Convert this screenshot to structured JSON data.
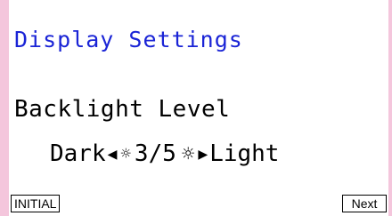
{
  "screen": {
    "title": "Display Settings",
    "setting_label": "Backlight Level"
  },
  "backlight": {
    "dark_label": "Dark",
    "light_label": "Light",
    "level_text": "3/5",
    "left_arrow": "◀",
    "right_arrow": "▶",
    "sun_small": "☼",
    "sun_large": "☼"
  },
  "function_keys": {
    "f1_label": "INITIAL",
    "f6_label": "Next"
  },
  "colors": {
    "title": "#1a24d6",
    "side_bar": "#f4c6dc"
  },
  "icons": [
    "left-arrow-icon",
    "sun-small-icon",
    "sun-large-icon",
    "right-arrow-icon"
  ]
}
